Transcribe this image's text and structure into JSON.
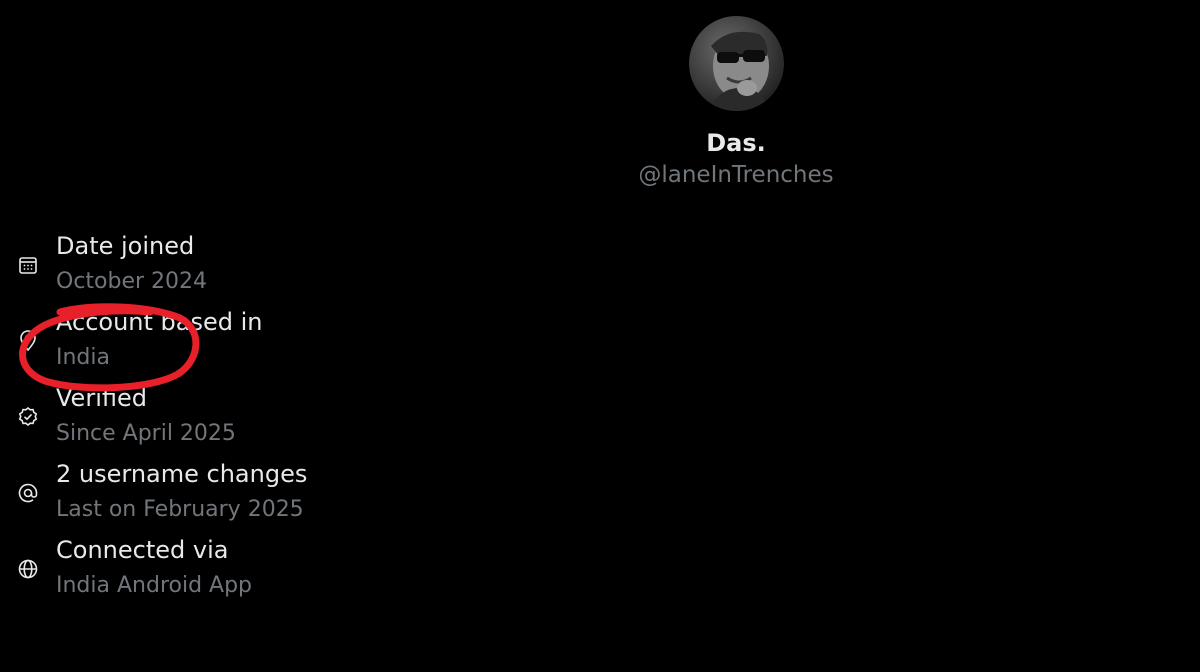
{
  "profile": {
    "display_name": "Das.",
    "handle": "@laneInTrenches",
    "avatar_icon": "profile-photo"
  },
  "info": {
    "items": [
      {
        "icon": "calendar-icon",
        "label": "Date joined",
        "value": "October 2024"
      },
      {
        "icon": "location-icon",
        "label": "Account based in",
        "value": "India"
      },
      {
        "icon": "verified-badge-icon",
        "label": "Verified",
        "value": "Since April 2025"
      },
      {
        "icon": "at-sign-icon",
        "label": "2 username changes",
        "value": "Last on February 2025"
      },
      {
        "icon": "globe-icon",
        "label": "Connected via",
        "value": "India Android App"
      }
    ]
  },
  "colors": {
    "background": "#000000",
    "primary_text": "#e7e9ea",
    "secondary_text": "#71767b",
    "annotation": "#e8202a"
  }
}
